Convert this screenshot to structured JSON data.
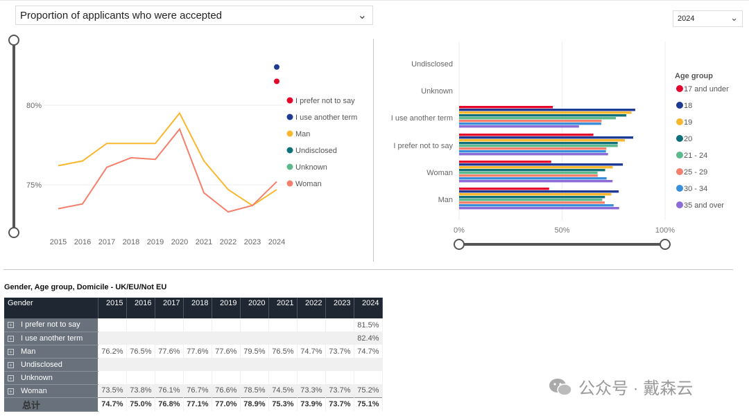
{
  "measure_dropdown": {
    "value": "Proportion of applicants who were accepted"
  },
  "year_dropdown": {
    "value": "2024"
  },
  "chart_data": [
    {
      "type": "line",
      "ylim": [
        72,
        84
      ],
      "yticks": [
        "75%",
        "80%"
      ],
      "ytick_values": [
        75,
        80
      ],
      "x": [
        "2015",
        "2016",
        "2017",
        "2018",
        "2019",
        "2020",
        "2021",
        "2022",
        "2023",
        "2024"
      ],
      "series": [
        {
          "name": "I prefer not to say",
          "color": "#E3072B",
          "values": [
            null,
            null,
            null,
            null,
            null,
            null,
            null,
            null,
            null,
            81.5
          ]
        },
        {
          "name": "I use another term",
          "color": "#1F3A93",
          "values": [
            null,
            null,
            null,
            null,
            null,
            null,
            null,
            null,
            null,
            82.4
          ]
        },
        {
          "name": "Man",
          "color": "#F9B72E",
          "values": [
            76.2,
            76.5,
            77.6,
            77.6,
            77.6,
            79.5,
            76.5,
            74.7,
            73.7,
            74.7
          ]
        },
        {
          "name": "Undisclosed",
          "color": "#0E7078",
          "values": []
        },
        {
          "name": "Unknown",
          "color": "#5BB98C",
          "values": []
        },
        {
          "name": "Woman",
          "color": "#F47F6C",
          "values": [
            73.5,
            73.8,
            76.1,
            76.7,
            76.6,
            78.5,
            74.5,
            73.3,
            73.7,
            75.2
          ]
        }
      ],
      "grid": true,
      "legend": "right"
    },
    {
      "type": "bar",
      "orientation": "horizontal",
      "xlim": [
        0,
        100
      ],
      "xticks": [
        "0%",
        "50%",
        "100%"
      ],
      "xtick_values": [
        0,
        50,
        100
      ],
      "categories": [
        "Undisclosed",
        "Unknown",
        "I use another term",
        "I prefer not to say",
        "Woman",
        "Man"
      ],
      "legend_title": "Age group",
      "legend": "right",
      "series": [
        {
          "name": "17 and under",
          "color": "#E3072B",
          "values": [
            null,
            null,
            45.5,
            65.2,
            44.7,
            43.7
          ]
        },
        {
          "name": "18",
          "color": "#1F3A93",
          "values": [
            null,
            null,
            85.5,
            84.5,
            79.5,
            77.5
          ]
        },
        {
          "name": "19",
          "color": "#F9B72E",
          "values": [
            null,
            null,
            83.7,
            80.5,
            74.6,
            73.9
          ]
        },
        {
          "name": "20",
          "color": "#0E7078",
          "values": [
            null,
            null,
            81.2,
            77.0,
            70.9,
            70.8
          ]
        },
        {
          "name": "21 - 24",
          "color": "#5BB98C",
          "values": [
            null,
            null,
            76.1,
            77.0,
            67.2,
            69.5
          ]
        },
        {
          "name": "25 - 29",
          "color": "#F47F6C",
          "values": [
            null,
            null,
            69.2,
            71.5,
            67.3,
            70.7
          ]
        },
        {
          "name": "30 - 34",
          "color": "#3A8FDB",
          "values": [
            null,
            null,
            69.0,
            71.3,
            71.6,
            75.0
          ]
        },
        {
          "name": "35 and over",
          "color": "#8C6BD6",
          "values": [
            null,
            null,
            58.2,
            72.3,
            74.5,
            77.7
          ]
        }
      ]
    }
  ],
  "table": {
    "title": "Gender, Age group, Domicile - UK/EU/Not EU",
    "header": "Gender",
    "columns": [
      "2015",
      "2016",
      "2017",
      "2018",
      "2019",
      "2020",
      "2021",
      "2022",
      "2023",
      "2024"
    ],
    "rows": [
      {
        "label": "I prefer not to say",
        "cells": [
          "",
          "",
          "",
          "",
          "",
          "",
          "",
          "",
          "",
          "81.5%"
        ]
      },
      {
        "label": "I use another term",
        "cells": [
          "",
          "",
          "",
          "",
          "",
          "",
          "",
          "",
          "",
          "82.4%"
        ]
      },
      {
        "label": "Man",
        "cells": [
          "76.2%",
          "76.5%",
          "77.6%",
          "77.6%",
          "77.6%",
          "79.5%",
          "76.5%",
          "74.7%",
          "73.7%",
          "74.7%"
        ]
      },
      {
        "label": "Undisclosed",
        "cells": [
          "",
          "",
          "",
          "",
          "",
          "",
          "",
          "",
          "",
          ""
        ]
      },
      {
        "label": "Unknown",
        "cells": [
          "",
          "",
          "",
          "",
          "",
          "",
          "",
          "",
          "",
          ""
        ]
      },
      {
        "label": "Woman",
        "cells": [
          "73.5%",
          "73.8%",
          "76.1%",
          "76.7%",
          "76.6%",
          "78.5%",
          "74.5%",
          "73.3%",
          "73.7%",
          "75.2%"
        ]
      }
    ],
    "total": {
      "label": "总计",
      "cells": [
        "74.7%",
        "75.0%",
        "76.8%",
        "77.1%",
        "77.0%",
        "78.9%",
        "75.3%",
        "73.9%",
        "73.7%",
        "75.1%"
      ]
    }
  },
  "watermark": "公众号 · 戴森云"
}
